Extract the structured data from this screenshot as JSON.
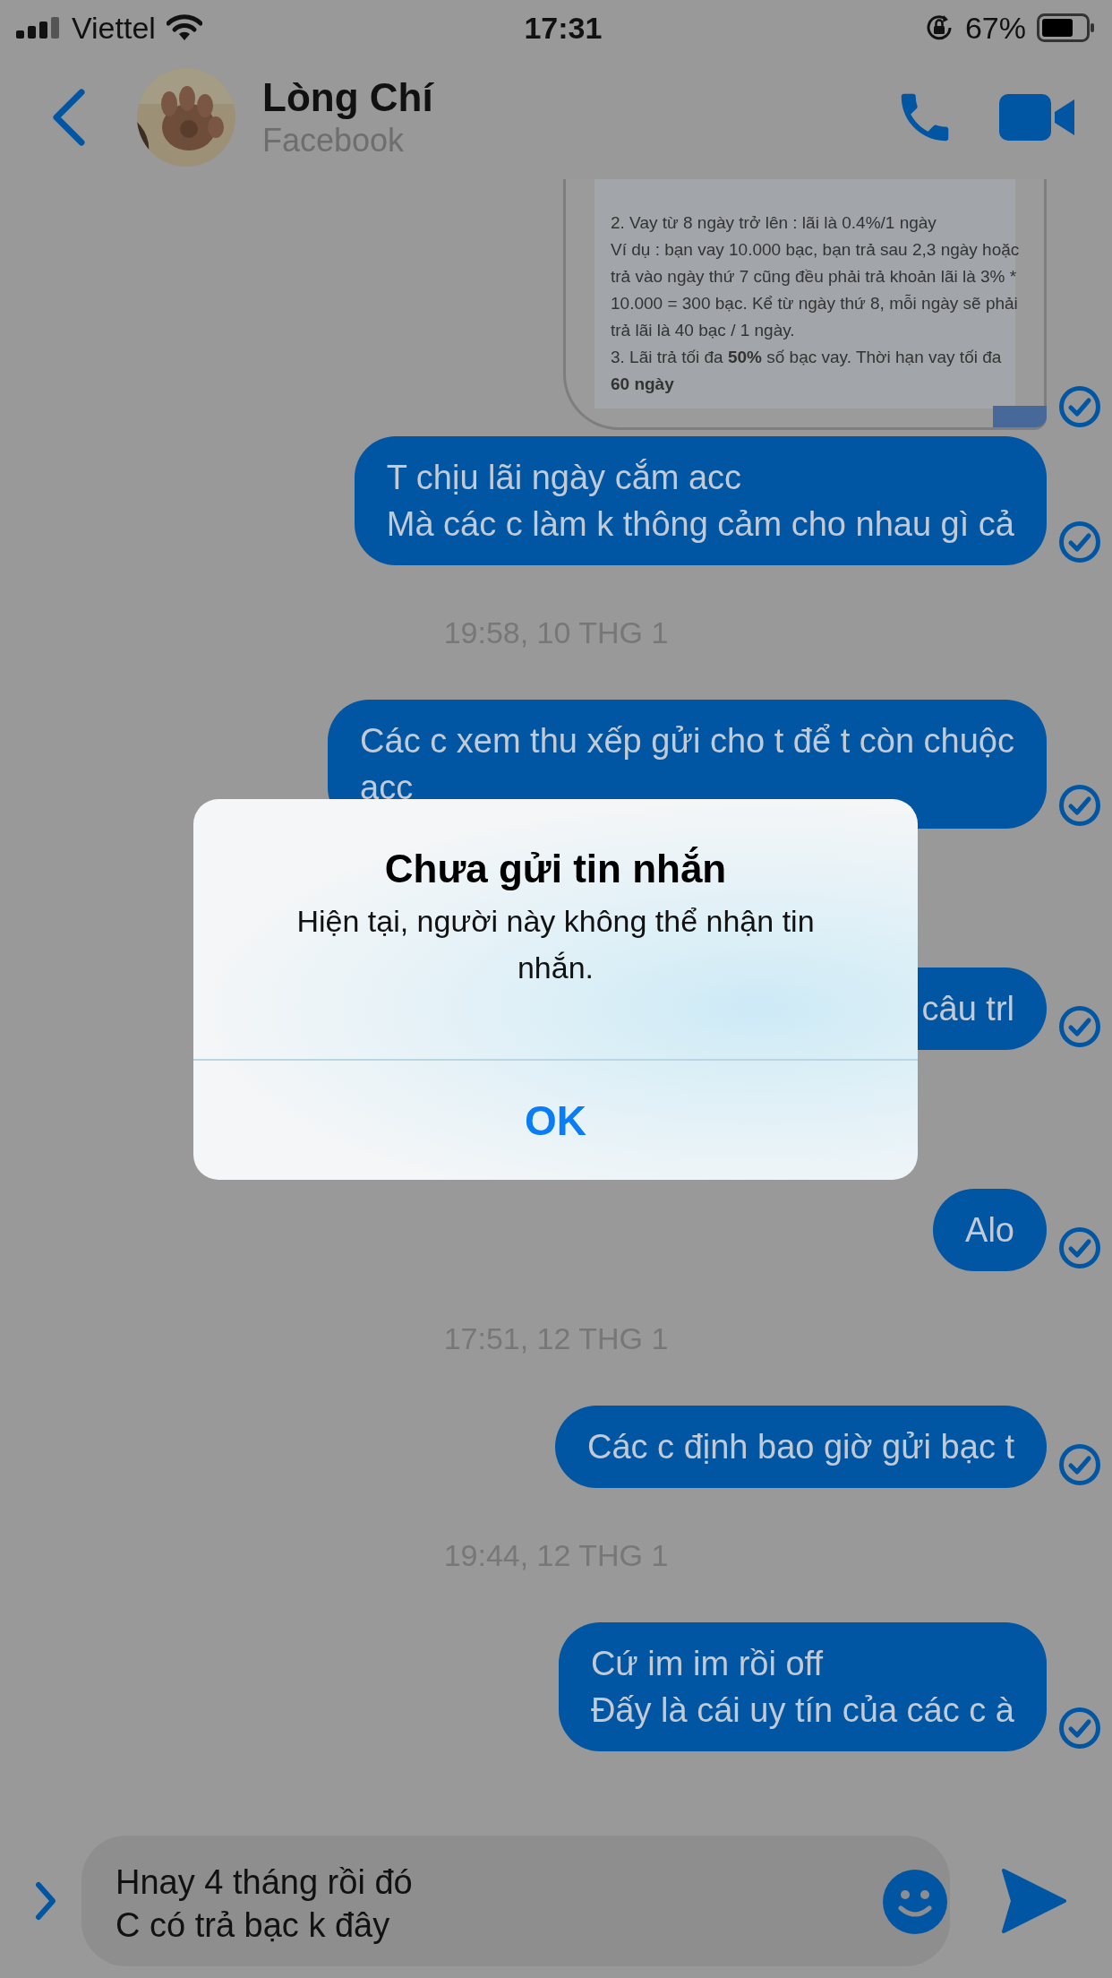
{
  "status_bar": {
    "carrier": "Viettel",
    "time": "17:31",
    "battery": "67%"
  },
  "header": {
    "name": "Lòng Chí",
    "subtitle": "Facebook"
  },
  "messages": [
    {
      "seen": true,
      "lines": [
        "2. Vay từ 8 ngày trở lên : lãi là 0.4%/1 ngày",
        "Ví dụ : bạn vay 10.000 bạc, bạn trả sau 2,3 ngày hoặc",
        "trả vào ngày thứ 7 cũng đều phải trả khoản lãi là 3% *",
        "10.000 = 300 bạc. Kể từ ngày thứ 8, mỗi ngày sẽ phải",
        "trả lãi là 40 bạc / 1 ngày.",
        "3. Lãi trả tối đa **50%** số bạc vay. Thời hạn vay tối đa",
        "**60 ngày**"
      ]
    },
    {
      "kind": "bubble",
      "seen": true,
      "covered": false,
      "lines": [
        "T chịu lãi ngày cắm acc",
        "Mà các c làm k thông cảm cho nhau gì cả"
      ]
    },
    {
      "kind": "timestamp",
      "text": "19:58, 10 THG 1"
    },
    {
      "kind": "bubble",
      "seen": true,
      "covered": false,
      "lines": [
        "Các c xem thu xếp gửi cho t để t còn chuộc",
        "acc"
      ]
    },
    {
      "kind": "bubble",
      "seen": true,
      "covered": true,
      "lines": [
        "câu trl"
      ]
    },
    {
      "kind": "bubble",
      "seen": true,
      "covered": false,
      "lines": [
        "Alo"
      ]
    },
    {
      "kind": "timestamp",
      "text": "17:51, 12 THG 1"
    },
    {
      "kind": "bubble",
      "seen": true,
      "covered": false,
      "lines": [
        "Các c định bao giờ gửi bạc t"
      ]
    },
    {
      "kind": "timestamp",
      "text": "19:44, 12 THG 1"
    },
    {
      "kind": "bubble",
      "seen": true,
      "covered": false,
      "lines": [
        "Cứ im im rồi off",
        "Đấy là cái uy tín của các c à"
      ]
    }
  ],
  "composer": {
    "value_lines": [
      "Hnay 4 tháng rồi đó",
      "C có trả bạc k đây"
    ]
  },
  "alert": {
    "title": "Chưa gửi tin nhắn",
    "message": "Hiện tại, người này không thể nhận tin nhắn.",
    "button": "OK"
  }
}
